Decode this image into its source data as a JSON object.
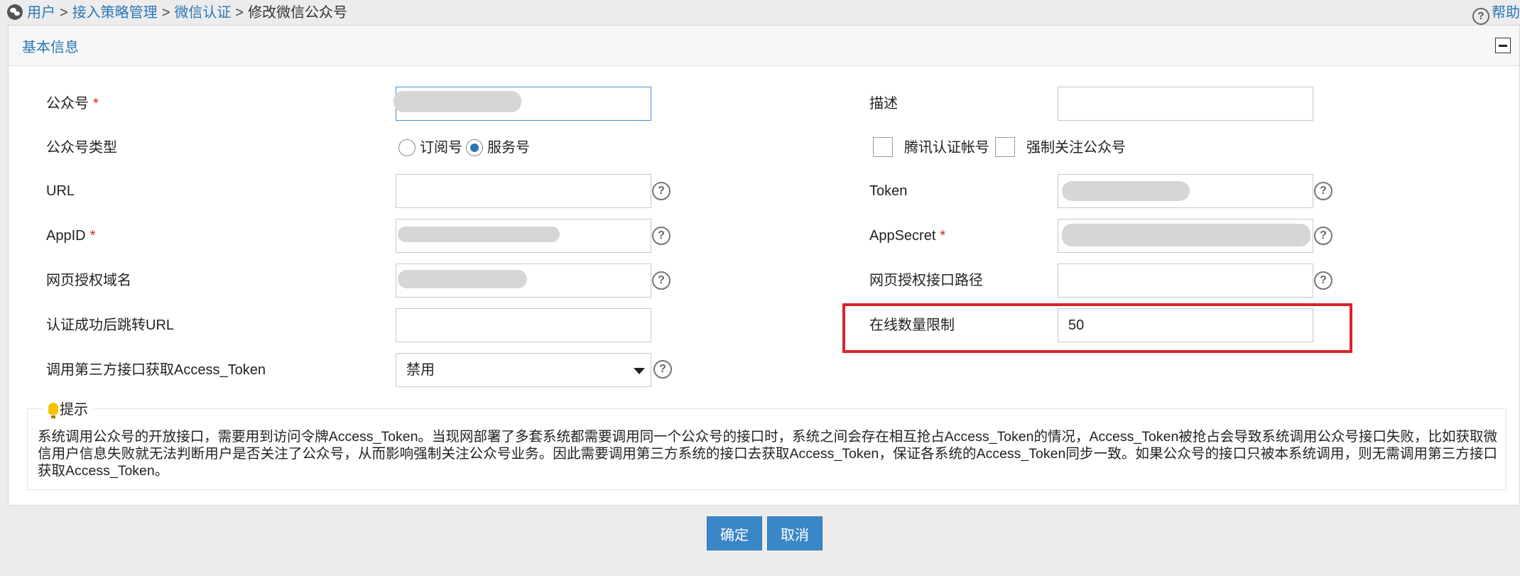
{
  "breadcrumb": {
    "items": [
      "用户",
      "接入策略管理",
      "微信认证"
    ],
    "separator": ">",
    "current": "修改微信公众号"
  },
  "help_label": "帮助",
  "panel": {
    "title": "基本信息"
  },
  "form": {
    "account": {
      "label": "公众号",
      "required": "*",
      "value": ""
    },
    "description": {
      "label": "描述",
      "value": ""
    },
    "account_type": {
      "label": "公众号类型",
      "options": [
        "订阅号",
        "服务号"
      ],
      "selected": "服务号"
    },
    "checkboxes": {
      "tencent_verified": "腾讯认证帐号",
      "force_follow": "强制关注公众号"
    },
    "url": {
      "label": "URL",
      "value": ""
    },
    "token": {
      "label": "Token",
      "value": "3"
    },
    "appid": {
      "label": "AppID",
      "required": "*",
      "value": ""
    },
    "appsecret": {
      "label": "AppSecret",
      "required": "*",
      "value": ""
    },
    "oauth_domain": {
      "label": "网页授权域名",
      "value": ""
    },
    "oauth_path": {
      "label": "网页授权接口路径",
      "value": ""
    },
    "redirect_url": {
      "label": "认证成功后跳转URL",
      "value": ""
    },
    "online_limit": {
      "label": "在线数量限制",
      "value": "50"
    },
    "third_party_token": {
      "label": "调用第三方接口获取Access_Token",
      "selected": "禁用"
    }
  },
  "tip": {
    "title": "提示",
    "text": "系统调用公众号的开放接口，需要用到访问令牌Access_Token。当现网部署了多套系统都需要调用同一个公众号的接口时，系统之间会存在相互抢占Access_Token的情况，Access_Token被抢占会导致系统调用公众号接口失败，比如获取微信用户信息失败就无法判断用户是否关注了公众号，从而影响强制关注公众号业务。因此需要调用第三方系统的接口去获取Access_Token，保证各系统的Access_Token同步一致。如果公众号的接口只被本系统调用，则无需调用第三方接口获取Access_Token。"
  },
  "buttons": {
    "confirm": "确定",
    "cancel": "取消"
  },
  "help_glyph": "?",
  "colors": {
    "link": "#2b77b8",
    "primary_button": "#3a87c8",
    "required": "#e02020",
    "highlight": "#d9232d"
  }
}
